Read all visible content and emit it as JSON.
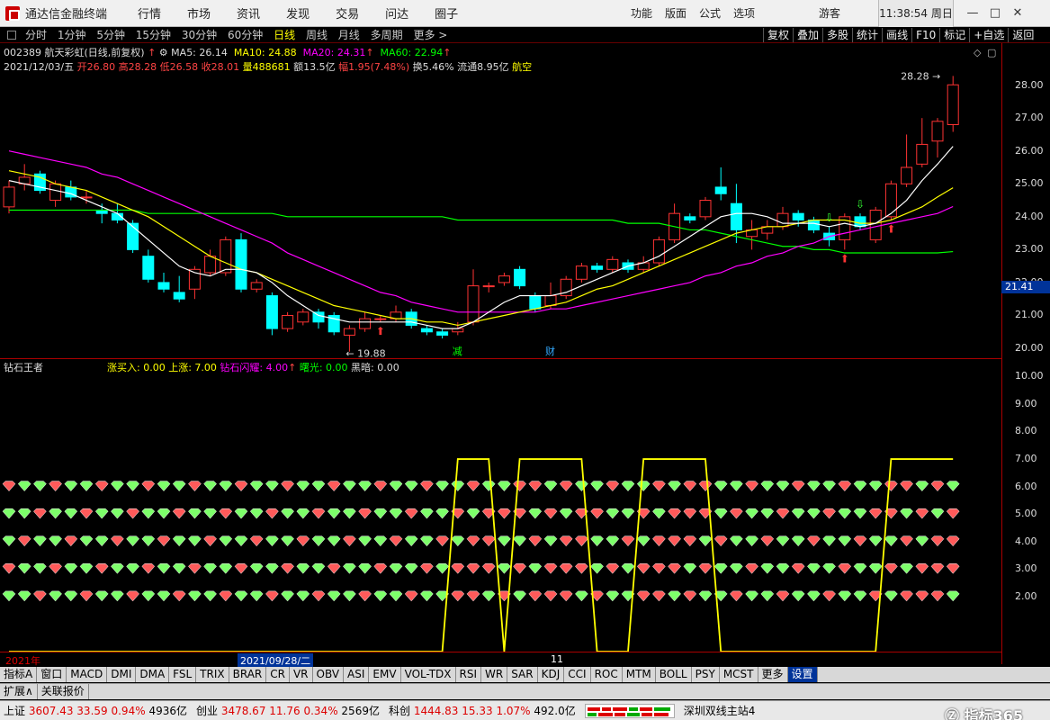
{
  "titlebar": {
    "app_title": "通达信金融终端",
    "menu": [
      "行情",
      "市场",
      "资讯",
      "发现",
      "交易",
      "问达",
      "圈子"
    ],
    "right_menu": [
      "功能",
      "版面",
      "公式",
      "选项"
    ],
    "guest": "游客",
    "clock": "11:38:54 周日",
    "win_min": "—",
    "win_max": "□",
    "win_close": "✕"
  },
  "toolbar": {
    "periods": [
      "分时",
      "1分钟",
      "5分钟",
      "15分钟",
      "30分钟",
      "60分钟",
      "日线",
      "周线",
      "月线",
      "多周期",
      "更多 >"
    ],
    "active_period": "日线",
    "tools": [
      "复权",
      "叠加",
      "多股",
      "统计",
      "画线",
      "F10",
      "标记",
      "+自选",
      "返回"
    ]
  },
  "stock": {
    "code_name": "002389 航天彩虹(日线,前复权)",
    "ma5": "MA5: 26.14",
    "ma10": "MA10: 24.88",
    "ma20": "MA20: 24.31",
    "ma60": "MA60: 22.94",
    "date": "2021/12/03/五",
    "open": "开26.80",
    "high": "高28.28",
    "low": "低26.58",
    "close": "收28.01",
    "volume": "量488681",
    "amount": "额13.5亿",
    "change": "幅1.95(7.48%)",
    "turnover": "换5.46%",
    "float_mv": "流通8.95亿",
    "sector": "航空"
  },
  "indicator": {
    "name": "钻石王者",
    "zhangmairu": "涨买入: 0.00",
    "shangzhang": "上涨: 7.00",
    "zuanshi": "钻石闪耀: 4.00",
    "shuguang": "曙光: 0.00",
    "heian": "黑暗: 0.00"
  },
  "price_axis": [
    "28.00",
    "27.00",
    "26.00",
    "25.00",
    "24.00",
    "23.00",
    "22.00",
    "21.00",
    "20.00"
  ],
  "indicator_axis": [
    "10.00",
    "9.00",
    "8.00",
    "7.00",
    "6.00",
    "5.00",
    "4.00",
    "3.00",
    "2.00"
  ],
  "price_tag": "21.41",
  "high_label": "28.28",
  "low_label": "19.88",
  "marks": {
    "jian": "减",
    "cai": "财"
  },
  "dates": {
    "year": "2021年",
    "selected": "2021/09/28/二",
    "month": "11"
  },
  "tabs": [
    "指标A",
    "窗口",
    "MACD",
    "DMI",
    "DMA",
    "FSL",
    "TRIX",
    "BRAR",
    "CR",
    "VR",
    "OBV",
    "ASI",
    "EMV",
    "VOL-TDX",
    "RSI",
    "WR",
    "SAR",
    "KDJ",
    "CCI",
    "ROC",
    "MTM",
    "BOLL",
    "PSY",
    "MCST",
    "更多",
    "设置"
  ],
  "subtabs": [
    "扩展∧",
    "关联报价"
  ],
  "status": {
    "sh_label": "上证",
    "sh_value": "3607.43",
    "sh_chg": "33.59",
    "sh_pct": "0.94%",
    "sh_amt": "4936亿",
    "cy_label": "创业",
    "cy_value": "3478.67",
    "cy_chg": "11.76",
    "cy_pct": "0.34%",
    "cy_amt": "2569亿",
    "kc_label": "科创",
    "kc_value": "1444.83",
    "kc_chg": "15.33",
    "kc_pct": "1.07%",
    "kc_amt": "492.0亿",
    "server": "深圳双线主站4"
  },
  "watermark": "指标365",
  "colors": {
    "up": "#ff3333",
    "down": "#00ffff",
    "ma5": "#ffffff",
    "ma10": "#ffff00",
    "ma20": "#ff00ff",
    "ma60": "#00ff00",
    "axis": "#aa0000"
  },
  "chart_data": {
    "type": "candlestick",
    "ylim": [
      19.7,
      28.4
    ],
    "candles": [
      [
        24.3,
        24.9,
        24.1,
        25.1
      ],
      [
        25.0,
        25.2,
        24.8,
        25.6
      ],
      [
        25.3,
        24.8,
        24.7,
        25.4
      ],
      [
        24.5,
        25.0,
        24.3,
        25.1
      ],
      [
        24.9,
        24.6,
        24.5,
        25.1
      ],
      [
        24.6,
        24.6,
        24.4,
        24.8
      ],
      [
        24.2,
        24.1,
        23.8,
        24.4
      ],
      [
        24.1,
        23.9,
        23.8,
        24.4
      ],
      [
        23.8,
        23.0,
        22.9,
        23.9
      ],
      [
        22.8,
        22.1,
        22.0,
        23.0
      ],
      [
        22.0,
        21.8,
        21.7,
        22.3
      ],
      [
        21.7,
        21.5,
        21.4,
        22.2
      ],
      [
        21.8,
        22.4,
        21.5,
        22.5
      ],
      [
        22.3,
        22.8,
        22.2,
        23.0
      ],
      [
        22.3,
        23.3,
        22.2,
        23.4
      ],
      [
        23.3,
        21.8,
        21.7,
        23.5
      ],
      [
        21.8,
        22.0,
        21.7,
        22.1
      ],
      [
        21.6,
        20.6,
        20.4,
        21.7
      ],
      [
        20.6,
        21.0,
        20.5,
        21.1
      ],
      [
        20.8,
        21.1,
        20.7,
        21.2
      ],
      [
        21.1,
        20.8,
        20.6,
        21.2
      ],
      [
        21.0,
        20.5,
        20.4,
        21.1
      ],
      [
        20.4,
        20.6,
        19.9,
        20.7
      ],
      [
        20.6,
        20.9,
        20.5,
        21.1
      ],
      [
        20.9,
        20.9,
        20.8,
        21.0
      ],
      [
        20.9,
        21.1,
        20.8,
        21.3
      ],
      [
        21.1,
        20.7,
        20.6,
        21.2
      ],
      [
        20.6,
        20.5,
        20.4,
        20.7
      ],
      [
        20.5,
        20.4,
        20.3,
        20.6
      ],
      [
        20.5,
        20.6,
        20.4,
        20.8
      ],
      [
        20.8,
        21.9,
        20.7,
        22.4
      ],
      [
        21.9,
        21.9,
        21.7,
        22.0
      ],
      [
        22.0,
        22.2,
        21.9,
        22.3
      ],
      [
        22.4,
        21.9,
        21.8,
        22.5
      ],
      [
        21.6,
        21.2,
        21.1,
        21.7
      ],
      [
        21.3,
        21.6,
        21.2,
        22.0
      ],
      [
        21.6,
        22.1,
        21.5,
        22.2
      ],
      [
        22.1,
        22.5,
        22.0,
        22.6
      ],
      [
        22.5,
        22.4,
        22.3,
        22.6
      ],
      [
        22.4,
        22.7,
        22.3,
        22.8
      ],
      [
        22.6,
        22.4,
        22.3,
        22.7
      ],
      [
        22.4,
        22.6,
        22.3,
        22.8
      ],
      [
        22.6,
        23.3,
        22.5,
        23.4
      ],
      [
        23.3,
        24.1,
        23.2,
        24.4
      ],
      [
        24.0,
        23.9,
        23.8,
        24.1
      ],
      [
        24.0,
        24.5,
        23.9,
        24.6
      ],
      [
        24.9,
        24.7,
        24.5,
        25.5
      ],
      [
        24.4,
        23.6,
        23.2,
        25.0
      ],
      [
        23.4,
        23.6,
        23.0,
        23.9
      ],
      [
        23.5,
        23.7,
        23.3,
        23.9
      ],
      [
        23.7,
        24.1,
        23.6,
        24.3
      ],
      [
        24.1,
        23.9,
        23.7,
        24.2
      ],
      [
        23.9,
        23.6,
        23.5,
        24.0
      ],
      [
        23.5,
        23.3,
        23.1,
        23.7
      ],
      [
        23.3,
        24.0,
        23.0,
        24.1
      ],
      [
        24.0,
        23.7,
        23.6,
        24.1
      ],
      [
        23.3,
        24.2,
        23.2,
        24.3
      ],
      [
        24.0,
        25.0,
        23.9,
        25.1
      ],
      [
        25.0,
        25.5,
        24.9,
        26.5
      ],
      [
        25.6,
        26.2,
        25.5,
        27.0
      ],
      [
        26.3,
        26.9,
        25.8,
        27.0
      ],
      [
        26.8,
        28.01,
        26.58,
        28.28
      ]
    ],
    "ma5": [
      25.1,
      25.0,
      24.9,
      24.8,
      24.7,
      24.5,
      24.3,
      24.1,
      23.7,
      23.3,
      22.9,
      22.5,
      22.3,
      22.2,
      22.4,
      22.4,
      22.3,
      22.0,
      21.6,
      21.3,
      21.0,
      20.9,
      20.8,
      20.8,
      20.8,
      20.8,
      20.8,
      20.7,
      20.6,
      20.6,
      20.8,
      21.1,
      21.4,
      21.6,
      21.6,
      21.6,
      21.7,
      21.9,
      22.1,
      22.3,
      22.5,
      22.6,
      22.8,
      23.1,
      23.4,
      23.7,
      24.0,
      24.1,
      24.1,
      24.0,
      23.8,
      23.8,
      23.8,
      23.7,
      23.8,
      23.7,
      23.8,
      24.1,
      24.5,
      25.1,
      25.6,
      26.14
    ],
    "ma10": [
      25.4,
      25.3,
      25.2,
      25.0,
      24.9,
      24.8,
      24.6,
      24.4,
      24.2,
      24.0,
      23.7,
      23.4,
      23.1,
      22.8,
      22.6,
      22.4,
      22.3,
      22.1,
      21.9,
      21.7,
      21.5,
      21.3,
      21.2,
      21.1,
      21.0,
      20.9,
      20.9,
      20.8,
      20.8,
      20.7,
      20.8,
      20.9,
      21.0,
      21.1,
      21.2,
      21.3,
      21.4,
      21.6,
      21.8,
      21.9,
      22.1,
      22.3,
      22.5,
      22.7,
      22.9,
      23.1,
      23.3,
      23.5,
      23.6,
      23.7,
      23.7,
      23.8,
      23.9,
      23.9,
      23.9,
      23.8,
      23.8,
      23.9,
      24.1,
      24.3,
      24.6,
      24.88
    ],
    "ma20": [
      26.0,
      25.9,
      25.8,
      25.7,
      25.6,
      25.5,
      25.3,
      25.2,
      25.0,
      24.8,
      24.6,
      24.4,
      24.2,
      24.0,
      23.8,
      23.6,
      23.4,
      23.2,
      22.9,
      22.7,
      22.5,
      22.3,
      22.1,
      21.9,
      21.7,
      21.6,
      21.4,
      21.3,
      21.2,
      21.1,
      21.1,
      21.1,
      21.1,
      21.1,
      21.1,
      21.2,
      21.2,
      21.3,
      21.4,
      21.5,
      21.6,
      21.7,
      21.8,
      21.9,
      22.0,
      22.2,
      22.3,
      22.5,
      22.6,
      22.8,
      22.9,
      23.1,
      23.2,
      23.4,
      23.5,
      23.6,
      23.7,
      23.8,
      23.9,
      24.0,
      24.1,
      24.31
    ],
    "ma60": [
      24.2,
      24.2,
      24.2,
      24.2,
      24.2,
      24.2,
      24.2,
      24.2,
      24.2,
      24.1,
      24.1,
      24.1,
      24.1,
      24.1,
      24.1,
      24.1,
      24.1,
      24.1,
      24.0,
      24.0,
      24.0,
      24.0,
      24.0,
      24.0,
      24.0,
      24.0,
      24.0,
      24.0,
      24.0,
      23.9,
      23.9,
      23.9,
      23.9,
      23.9,
      23.9,
      23.9,
      23.9,
      23.9,
      23.9,
      23.9,
      23.8,
      23.8,
      23.8,
      23.7,
      23.6,
      23.6,
      23.5,
      23.4,
      23.3,
      23.2,
      23.1,
      23.1,
      23.0,
      23.0,
      22.9,
      22.9,
      22.9,
      22.9,
      22.9,
      22.9,
      22.9,
      22.94
    ],
    "indicator_line": [
      0.0,
      0.0,
      0.0,
      0.0,
      0.0,
      0.0,
      0.0,
      0.0,
      0.0,
      0.0,
      0.0,
      0.0,
      0.0,
      0.0,
      0.0,
      0.0,
      0.0,
      0.0,
      0.0,
      0.0,
      0.0,
      0.0,
      0.0,
      0.0,
      0.0,
      0.0,
      0.0,
      0.0,
      0.0,
      7.0,
      7.0,
      7.0,
      0.0,
      7.0,
      7.0,
      7.0,
      7.0,
      7.0,
      0.0,
      0.0,
      0.0,
      7.0,
      7.0,
      7.0,
      7.0,
      7.0,
      0.0,
      0.0,
      0.0,
      0.0,
      0.0,
      0.0,
      0.0,
      0.0,
      0.0,
      0.0,
      0.0,
      7.0,
      7.0,
      7.0,
      7.0,
      7.0
    ],
    "diamond_rows": [
      6,
      5,
      4,
      3,
      2
    ],
    "indicator_ylim": [
      0,
      10.6
    ]
  }
}
